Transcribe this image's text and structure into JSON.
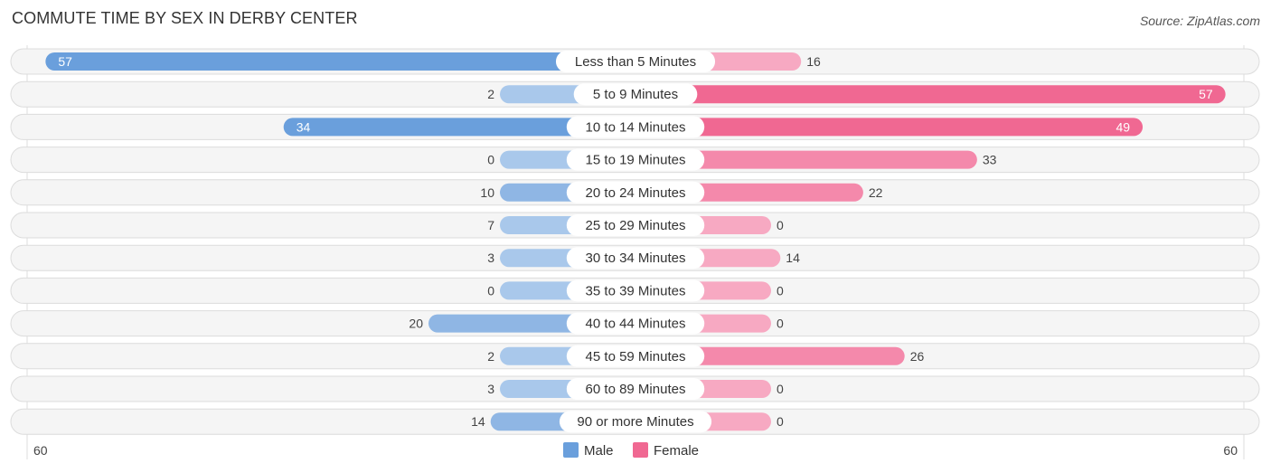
{
  "header": {
    "title": "COMMUTE TIME BY SEX IN DERBY CENTER",
    "source": "Source: ZipAtlas.com"
  },
  "colors": {
    "male_strong": "#6a9fdc",
    "male_light": "#a9c8eb",
    "female_strong": "#f06892",
    "female_light": "#f7a9c2",
    "row_bg": "#f3f3f3"
  },
  "chart_data": {
    "type": "bar",
    "orientation": "horizontal-diverging",
    "title": "COMMUTE TIME BY SEX IN DERBY CENTER",
    "categories": [
      "Less than 5 Minutes",
      "5 to 9 Minutes",
      "10 to 14 Minutes",
      "15 to 19 Minutes",
      "20 to 24 Minutes",
      "25 to 29 Minutes",
      "30 to 34 Minutes",
      "35 to 39 Minutes",
      "40 to 44 Minutes",
      "45 to 59 Minutes",
      "60 to 89 Minutes",
      "90 or more Minutes"
    ],
    "series": [
      {
        "name": "Male",
        "values": [
          57,
          2,
          34,
          0,
          10,
          7,
          3,
          0,
          20,
          2,
          3,
          14
        ]
      },
      {
        "name": "Female",
        "values": [
          16,
          57,
          49,
          33,
          22,
          0,
          14,
          0,
          0,
          26,
          0,
          0
        ]
      }
    ],
    "axis": {
      "left_label": "60",
      "right_label": "60",
      "range": [
        -60,
        60
      ]
    },
    "legend": {
      "items": [
        "Male",
        "Female"
      ],
      "placement": "bottom-center"
    }
  }
}
